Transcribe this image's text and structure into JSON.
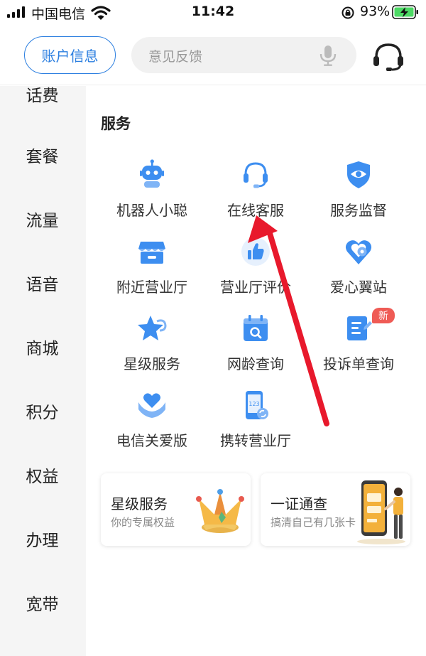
{
  "status_bar": {
    "carrier": "中国电信",
    "time": "11:42",
    "battery": "93%"
  },
  "header": {
    "account_label": "账户信息",
    "search_placeholder": "意见反馈"
  },
  "sidebar": {
    "items": [
      {
        "label": "话费"
      },
      {
        "label": "套餐"
      },
      {
        "label": "流量"
      },
      {
        "label": "语音"
      },
      {
        "label": "商城"
      },
      {
        "label": "积分"
      },
      {
        "label": "权益"
      },
      {
        "label": "办理"
      },
      {
        "label": "宽带"
      }
    ]
  },
  "services": {
    "title": "服务",
    "items": [
      {
        "label": "机器人小聪",
        "icon": "robot-icon"
      },
      {
        "label": "在线客服",
        "icon": "headset-icon"
      },
      {
        "label": "服务监督",
        "icon": "shield-eye-icon"
      },
      {
        "label": "附近营业厅",
        "icon": "storefront-icon"
      },
      {
        "label": "营业厅评价",
        "icon": "thumbs-up-icon"
      },
      {
        "label": "爱心翼站",
        "icon": "heart-pin-icon"
      },
      {
        "label": "星级服务",
        "icon": "star-icon"
      },
      {
        "label": "网龄查询",
        "icon": "calendar-search-icon"
      },
      {
        "label": "投诉单查询",
        "icon": "document-icon",
        "badge": "新"
      },
      {
        "label": "电信关爱版",
        "icon": "heart-hands-icon"
      },
      {
        "label": "携转营业厅",
        "icon": "phone-transfer-icon"
      }
    ]
  },
  "promos": [
    {
      "title": "星级服务",
      "subtitle": "你的专属权益"
    },
    {
      "title": "一证通查",
      "subtitle": "搞清自己有几张卡"
    }
  ],
  "colors": {
    "accent": "#2c7fe0",
    "icon_blue": "#3d8ef0",
    "badge_red": "#ef5b55",
    "annotation_arrow": "#e8192c"
  }
}
